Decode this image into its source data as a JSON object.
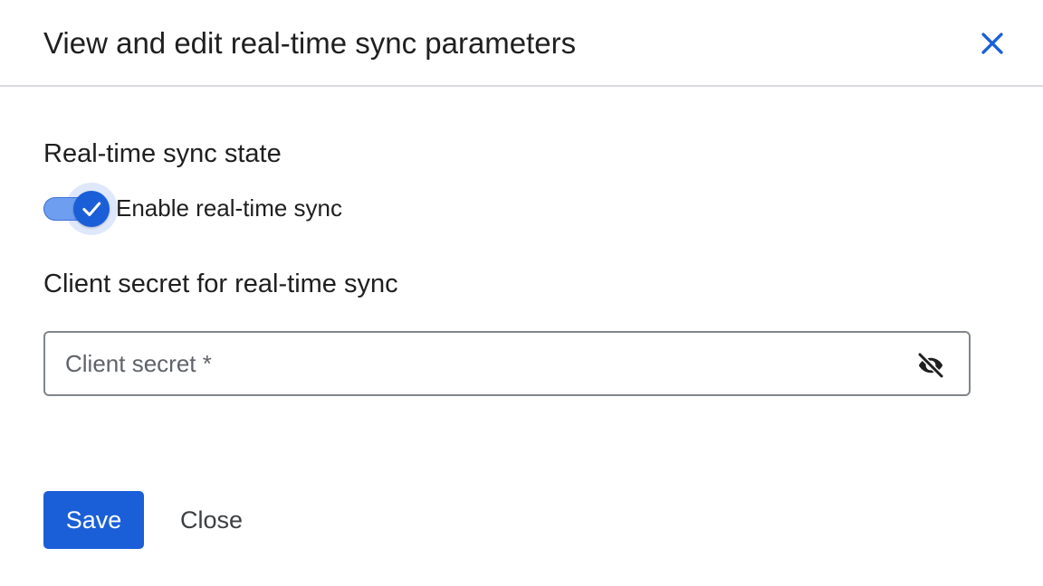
{
  "dialog": {
    "title": "View and edit real-time sync parameters",
    "close_icon": "close-icon"
  },
  "sync_state": {
    "heading": "Real-time sync state",
    "toggle_label": "Enable real-time sync",
    "enabled": true,
    "check_icon": "check-icon"
  },
  "client_secret": {
    "heading": "Client secret for real-time sync",
    "placeholder": "Client secret *",
    "value": "",
    "visibility_icon": "visibility-off-icon"
  },
  "actions": {
    "save_label": "Save",
    "close_label": "Close"
  },
  "colors": {
    "primary": "#1a5fd8",
    "track": "#6d9ef0",
    "text": "#1f1f1f",
    "border": "#80868b",
    "divider": "#dadce0"
  }
}
